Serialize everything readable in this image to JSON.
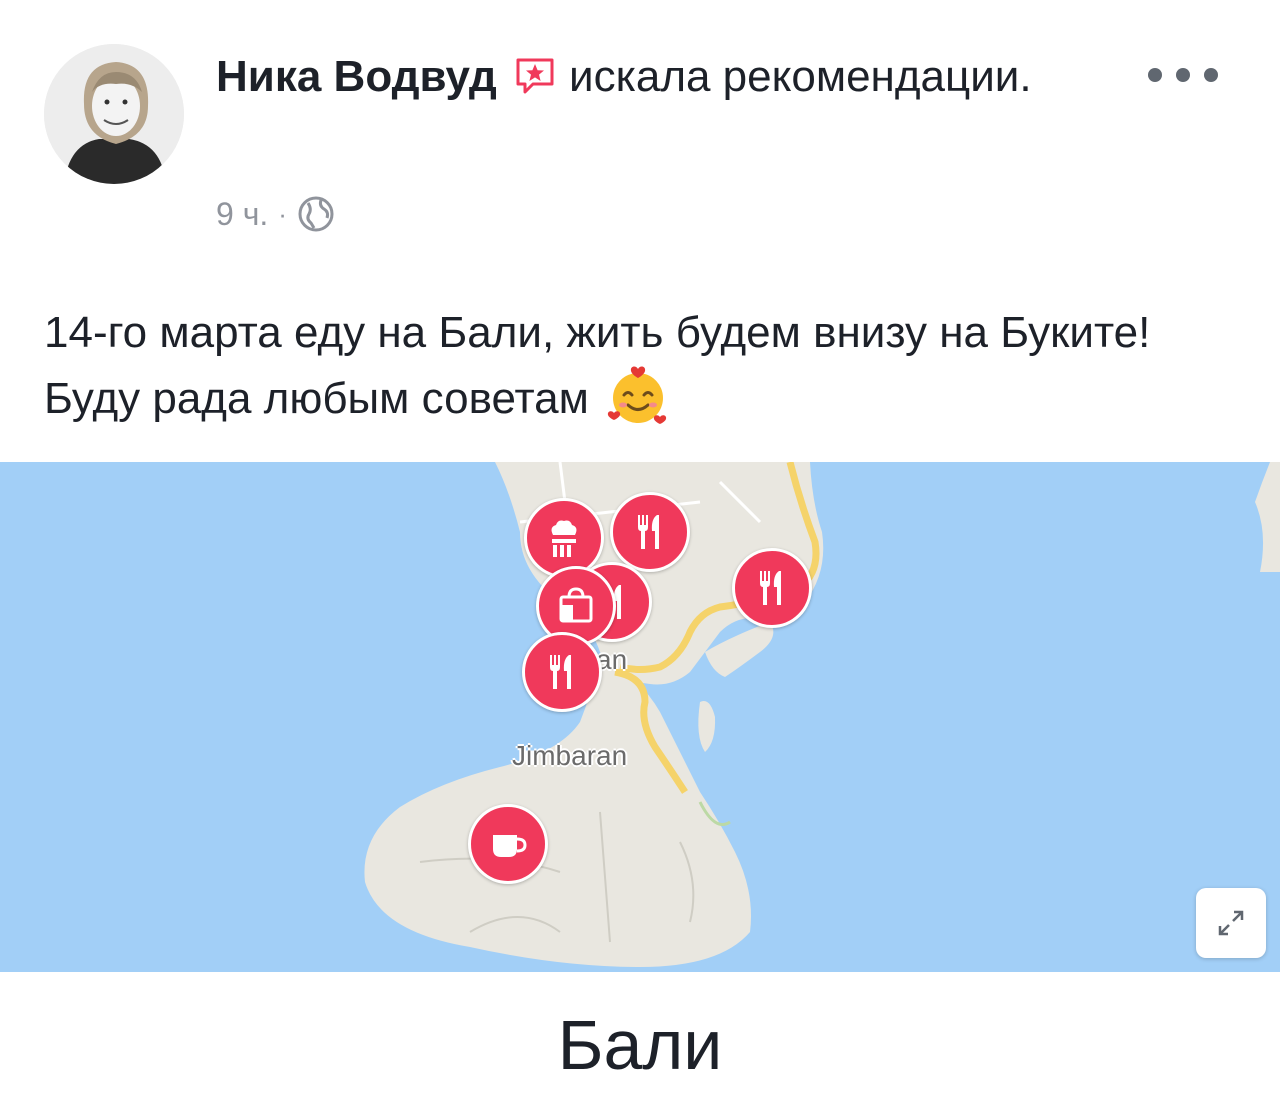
{
  "post": {
    "author": "Ника Водвуд",
    "action": "искала рекомендации.",
    "time": "9 ч.",
    "separator": "·",
    "text": "14-го марта еду на Бали, жить будем внизу на Буките! Буду рада любым советам"
  },
  "map": {
    "label_partial": "an",
    "label_jimbaran": "Jimbaran",
    "pins": [
      {
        "type": "bakery-icon"
      },
      {
        "type": "restaurant-icon"
      },
      {
        "type": "restaurant-icon"
      },
      {
        "type": "restaurant-icon"
      },
      {
        "type": "shopping-bag-icon"
      },
      {
        "type": "restaurant-icon"
      },
      {
        "type": "coffee-cup-icon"
      }
    ]
  },
  "place": {
    "title": "Бали"
  },
  "colors": {
    "pin": "#f0395b",
    "sea": "#a2cff7",
    "land": "#e9e7e0",
    "road": "#f5d36a",
    "meta_text": "#90949c",
    "badge": "#f0395b"
  }
}
